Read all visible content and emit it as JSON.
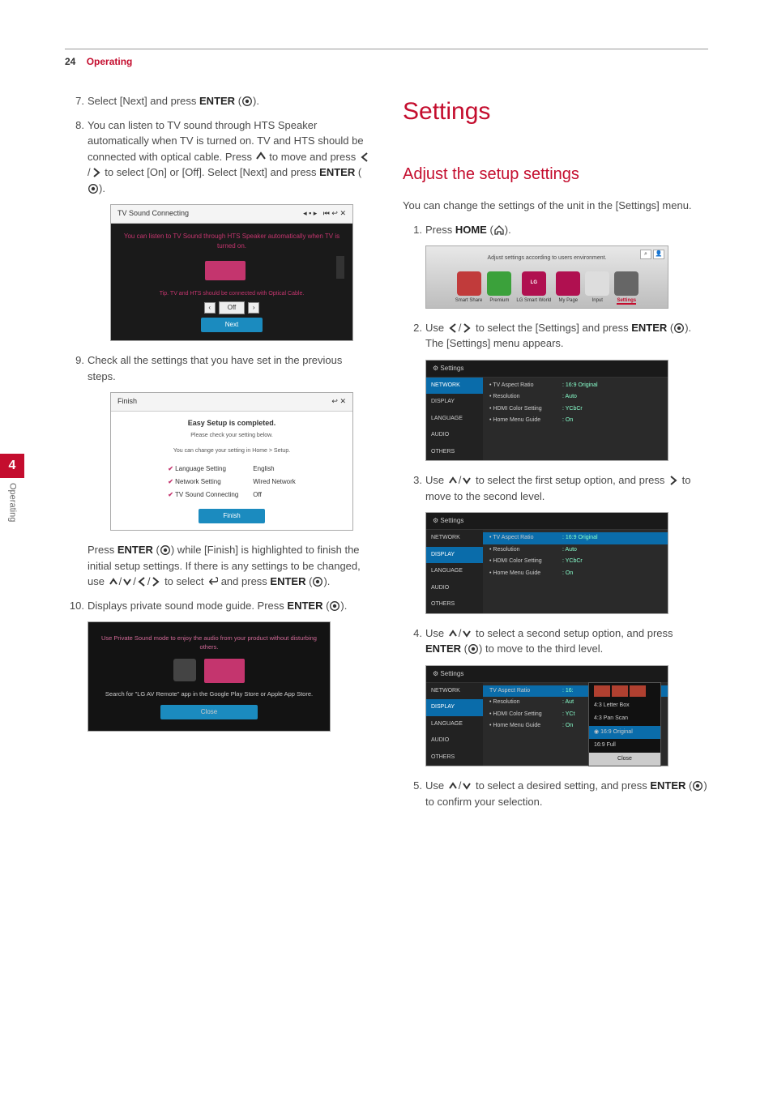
{
  "header": {
    "page_number": "24",
    "section": "Operating"
  },
  "side_tab": {
    "number": "4",
    "label": "Operating"
  },
  "left_col": {
    "step7": {
      "text_a": "Select [Next] and press ",
      "enter": "ENTER",
      "text_b": " (",
      "text_c": ")."
    },
    "step8": {
      "text_a": "You can listen to TV sound through HTS Speaker automatically when TV is turned on. TV and HTS should be connected with optical cable. Press ",
      "text_b": " to move and press ",
      "text_c": " to select [On] or [Off]. Select [Next] and press ",
      "enter": "ENTER",
      "text_d": " (",
      "text_e": ")."
    },
    "ss1": {
      "title": "TV Sound Connecting",
      "msg": "You can listen to TV Sound through HTS Speaker automatically when TV is turned on.",
      "tip": "Tip. TV and HTS should be connected with Optical Cable.",
      "off": "Off",
      "next": "Next"
    },
    "step9": "Check all the settings that you have set in the previous steps.",
    "ss2": {
      "title": "Finish",
      "done": "Easy Setup is completed.",
      "sub1": "Please check your setting below.",
      "sub2": "You can change your setting in Home > Setup.",
      "rows": [
        {
          "k": "Language Setting",
          "v": "English"
        },
        {
          "k": "Network Setting",
          "v": "Wired Network"
        },
        {
          "k": "TV Sound Connecting",
          "v": "Off"
        }
      ],
      "finish": "Finish"
    },
    "after9": {
      "a": "Press ",
      "enter": "ENTER",
      "b": " (",
      "c": ") while [Finish] is highlighted to finish the initial setup settings. If there is any settings to be changed, use ",
      "d": " to select ",
      "e": " and press ",
      "enter2": "ENTER",
      "f": " (",
      "g": ")."
    },
    "step10": {
      "a": "Displays private sound mode guide. Press ",
      "enter": "ENTER",
      "b": " (",
      "c": ")."
    },
    "ss3": {
      "msg": "Use Private Sound mode to enjoy the audio from your product without disturbing others.",
      "search": "Search for \"LG AV Remote\" app in the Google Play Store or Apple App Store.",
      "close": "Close"
    }
  },
  "right_col": {
    "h1": "Settings",
    "h2": "Adjust the setup settings",
    "intro": "You can change the settings of the unit in the [Settings] menu.",
    "step1": {
      "a": "Press ",
      "home": "HOME",
      "b": " (",
      "c": ")."
    },
    "ss_home": {
      "sub": "Adjust settings according to users environment.",
      "items": [
        "Smart Share",
        "Premium",
        "LG Smart World",
        "My Page",
        "Input",
        "Settings"
      ]
    },
    "step2": {
      "a": "Use ",
      "b": " to select the [Settings] and press ",
      "enter": "ENTER",
      "c": " (",
      "d": "). The [Settings] menu appears."
    },
    "settings_menu": {
      "title": "Settings",
      "cats": [
        "NETWORK",
        "DISPLAY",
        "LANGUAGE",
        "AUDIO",
        "OTHERS"
      ],
      "opts": [
        {
          "k": "TV Aspect Ratio",
          "v": ": 16:9 Original"
        },
        {
          "k": "Resolution",
          "v": ": Auto"
        },
        {
          "k": "HDMI Color Setting",
          "v": ": YCbCr"
        },
        {
          "k": "Home Menu Guide",
          "v": ": On"
        }
      ]
    },
    "step3": {
      "a": "Use ",
      "b": " to select the first setup option, and press ",
      "c": " to move to the second level."
    },
    "step4": {
      "a": "Use ",
      "b": " to select a second setup option, and press ",
      "enter": "ENTER",
      "c": " (",
      "d": ") to move to the third level."
    },
    "ss_third": {
      "options": [
        "4:3 Letter Box",
        "4:3 Pan Scan",
        "16:9 Original",
        "16:9 Full"
      ],
      "close": "Close"
    },
    "step5": {
      "a": "Use ",
      "b": " to select a desired setting, and press ",
      "enter": "ENTER",
      "c": " (",
      "d": ") to confirm your selection."
    }
  }
}
